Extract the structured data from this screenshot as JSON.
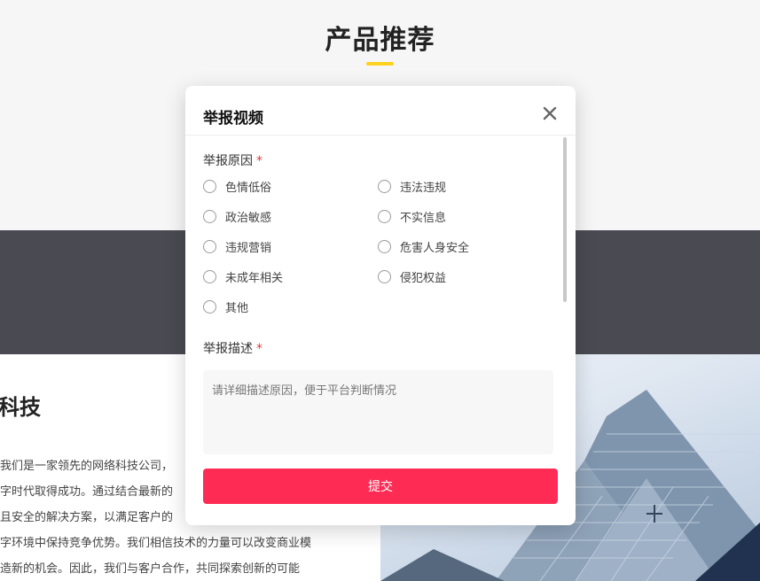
{
  "page": {
    "section_title": "产品推荐",
    "about_heading": "科技",
    "about_lines": [
      "我们是一家领先的网络科技公司，",
      "字时代取得成功。通过结合最新的",
      "且安全的解决方案，以满足客户的",
      "字环境中保持竞争优势。我们相信技术的力量可以改变商业模",
      "造新的机会。因此，我们与客户合作，共同探索创新的可能"
    ]
  },
  "modal": {
    "title": "举报视频",
    "close_icon": "close-icon",
    "reason_label": "举报原因",
    "required_mark": "*",
    "reasons": [
      "色情低俗",
      "违法违规",
      "政治敏感",
      "不实信息",
      "违规营销",
      "危害人身安全",
      "未成年相关",
      "侵犯权益",
      "其他"
    ],
    "description_label": "举报描述",
    "description_placeholder": "请详细描述原因，便于平台判断情况",
    "description_value": "",
    "submit_label": "提交"
  },
  "colors": {
    "accent": "#fe2c55",
    "underline": "#ffd21f",
    "band": "#4a4a52",
    "required": "#e23a3a"
  }
}
